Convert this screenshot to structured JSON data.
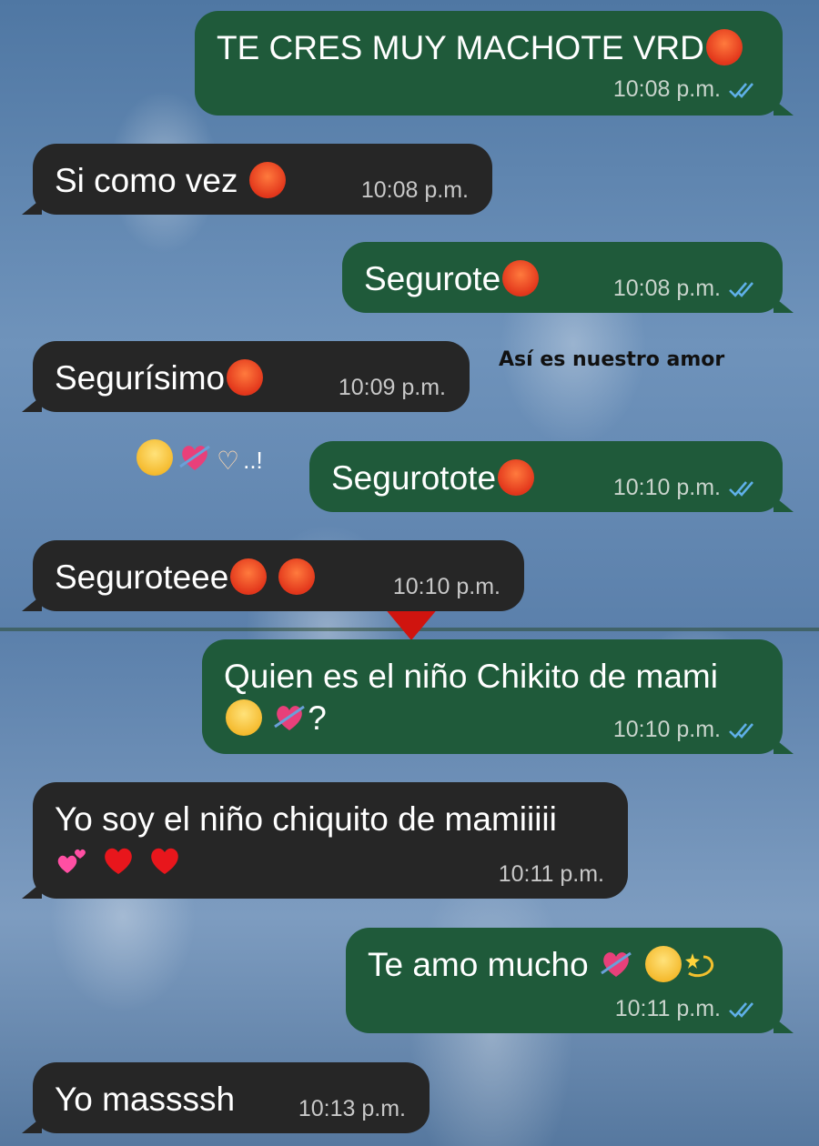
{
  "overlay_caption": "Así es nuestro amor",
  "sticker_text": "..!",
  "messages": [
    {
      "text": "TE CRES MUY MACHOTE VRD",
      "time": "10:08 p.m."
    },
    {
      "text": "Si como vez",
      "time": "10:08 p.m."
    },
    {
      "text": "Segurote",
      "time": "10:08 p.m."
    },
    {
      "text": "Segurísimo",
      "time": "10:09 p.m."
    },
    {
      "text": "Segurotote",
      "time": "10:10 p.m."
    },
    {
      "text": "Seguroteee",
      "time": "10:10 p.m."
    },
    {
      "text": "Quien es el niño Chikito de mami",
      "text2": "?",
      "time": "10:10 p.m."
    },
    {
      "text": "Yo soy el niño chiquito de mamiiiii",
      "time": "10:11 p.m."
    },
    {
      "text": "Te amo mucho",
      "time": "10:11 p.m."
    },
    {
      "text": "Yo massssh",
      "time": "10:13 p.m."
    }
  ],
  "colors": {
    "outgoing": "#1f5a3a",
    "incoming": "#262626",
    "read_ticks": "#5fb0e8"
  }
}
